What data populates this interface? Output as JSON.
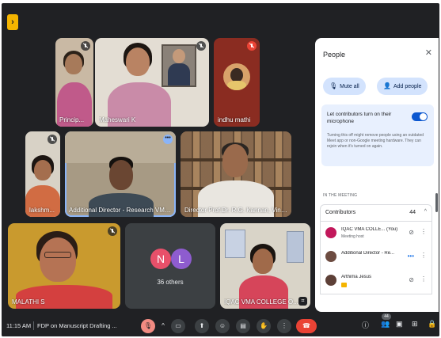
{
  "app_badge": "›",
  "tiles": {
    "principal": {
      "name": "Princip..."
    },
    "maheswari": {
      "name": "Maheswari K"
    },
    "indhu": {
      "name": "indhu mathi"
    },
    "lakshmi": {
      "name": "lakshm..."
    },
    "addl_director": {
      "name": "Additional Director - Research VMRF..."
    },
    "director_rg": {
      "name": "Director Prof.Dr. R.G. Kannan, Vinaya..."
    },
    "malathi": {
      "name": "MALATHI S"
    },
    "others": {
      "avatar1": "N",
      "avatar2": "L",
      "label": "36 others",
      "avatar1_color": "#e8506a",
      "avatar2_color": "#8e5ccf"
    },
    "iqac": {
      "name": "IQAC VMA COLLEGE O..."
    }
  },
  "panel": {
    "title": "People",
    "close_icon": "✕",
    "mute_all": "Mute all",
    "add_people": "Add people",
    "contrib_setting_title": "Let contributors turn on their microphone",
    "contrib_setting_desc": "Turning this off might remove people using an outdated Meet app or non-Google meeting hardware. They can rejoin when it's turned on again.",
    "section_label": "IN THE MEETING",
    "contributors_label": "Contributors",
    "contributors_count": "44",
    "participants": [
      {
        "name": "IQAC VMA COLLE... (You)",
        "sub": "Meeting host",
        "avatar_color": "#c2185b"
      },
      {
        "name": "Additional Director - Re...",
        "sub": "",
        "avatar_color": "#6d4c41"
      },
      {
        "name": "Arthima Jesus",
        "sub": "",
        "avatar_color": "#5d4037"
      }
    ]
  },
  "bottom_bar": {
    "time": "11:15 AM",
    "meeting_title": "FDP on Manuscript Drafting ...",
    "people_badge": "44",
    "colors": {
      "end_call": "#ea4335",
      "mic_muted": "#f28b82"
    }
  }
}
